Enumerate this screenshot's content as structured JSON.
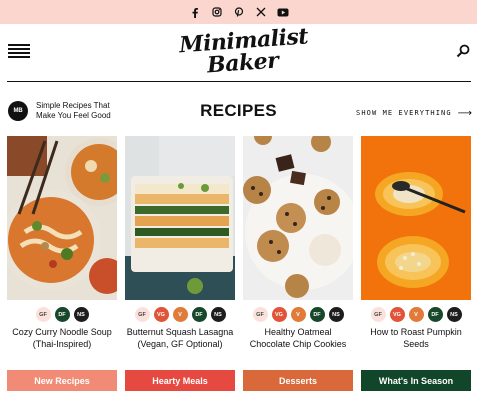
{
  "social": [
    {
      "icon": "facebook-icon"
    },
    {
      "icon": "instagram-icon"
    },
    {
      "icon": "pinterest-icon"
    },
    {
      "icon": "x-twitter-icon"
    },
    {
      "icon": "youtube-icon"
    }
  ],
  "header": {
    "logo_line1": "Minimalist",
    "logo_line2": "Baker"
  },
  "section": {
    "badge": "MB",
    "tagline": "Simple Recipes That Make You Feel Good",
    "title": "RECIPES",
    "show_all": "SHOW ME EVERYTHING"
  },
  "cards": [
    {
      "title": "Cozy Curry Noodle Soup (Thai-Inspired)",
      "tags": [
        "GF",
        "DF",
        "NS"
      ]
    },
    {
      "title": "Butternut Squash Lasagna (Vegan, GF Optional)",
      "tags": [
        "GF",
        "VG",
        "V",
        "DF",
        "NS"
      ]
    },
    {
      "title": "Healthy Oatmeal Chocolate Chip Cookies",
      "tags": [
        "GF",
        "VG",
        "V",
        "DF",
        "NS"
      ]
    },
    {
      "title": "How to Roast Pumpkin Seeds",
      "tags": [
        "GF",
        "VG",
        "V",
        "DF",
        "NS"
      ]
    }
  ],
  "categories": [
    {
      "label": "New Recipes",
      "color": "#f28b76"
    },
    {
      "label": "Hearty Meals",
      "color": "#e6493f"
    },
    {
      "label": "Desserts",
      "color": "#d9683a"
    },
    {
      "label": "What's In Season",
      "color": "#12462a"
    }
  ],
  "colors": {
    "social_bar": "#fad6cf",
    "tag_gf": "#fbe1dc",
    "tag_vg": "#e0543a",
    "tag_v": "#e07b3a",
    "tag_df": "#17482b",
    "tag_ns": "#1d1d1d"
  }
}
